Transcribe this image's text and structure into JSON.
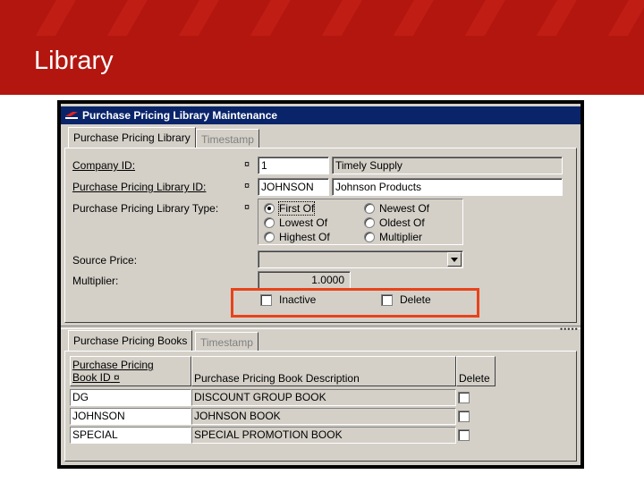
{
  "slide": {
    "title": "Library"
  },
  "window": {
    "title": "Purchase Pricing Library Maintenance"
  },
  "tabs_top": [
    "Purchase Pricing Library",
    "Timestamp"
  ],
  "form": {
    "required_marker": "¤",
    "company_id": {
      "label": "Company ID:",
      "value": "1",
      "description": "Timely Supply"
    },
    "library_id": {
      "label": "Purchase Pricing Library ID:",
      "value": "JOHNSON",
      "description": "Johnson Products"
    },
    "library_type": {
      "label": "Purchase Pricing Library Type:",
      "options": [
        "First Of",
        "Lowest Of",
        "Highest Of",
        "Newest Of",
        "Oldest Of",
        "Multiplier"
      ],
      "selected": "First Of"
    },
    "source_price": {
      "label": "Source Price:",
      "value": ""
    },
    "multiplier": {
      "label": "Multiplier:",
      "value": "1.0000"
    },
    "inactive": {
      "label": "Inactive",
      "checked": false
    },
    "delete": {
      "label": "Delete",
      "checked": false
    }
  },
  "tabs_bottom": [
    "Purchase Pricing Books",
    "Timestamp"
  ],
  "books_grid": {
    "col_id_line1": "Purchase Pricing",
    "col_id_line2": "Book ID",
    "col_id_marker": "¤",
    "col_desc": "Purchase Pricing Book Description",
    "col_delete": "Delete",
    "rows": [
      {
        "id": "DG",
        "description": "DISCOUNT GROUP BOOK"
      },
      {
        "id": "JOHNSON",
        "description": "JOHNSON BOOK"
      },
      {
        "id": "SPECIAL",
        "description": "SPECIAL PROMOTION BOOK"
      }
    ]
  },
  "colors": {
    "banner": "#b2160f",
    "titlebar": "#0a246a",
    "highlight": "#e8431a",
    "window_bg": "#d4d0c8"
  }
}
